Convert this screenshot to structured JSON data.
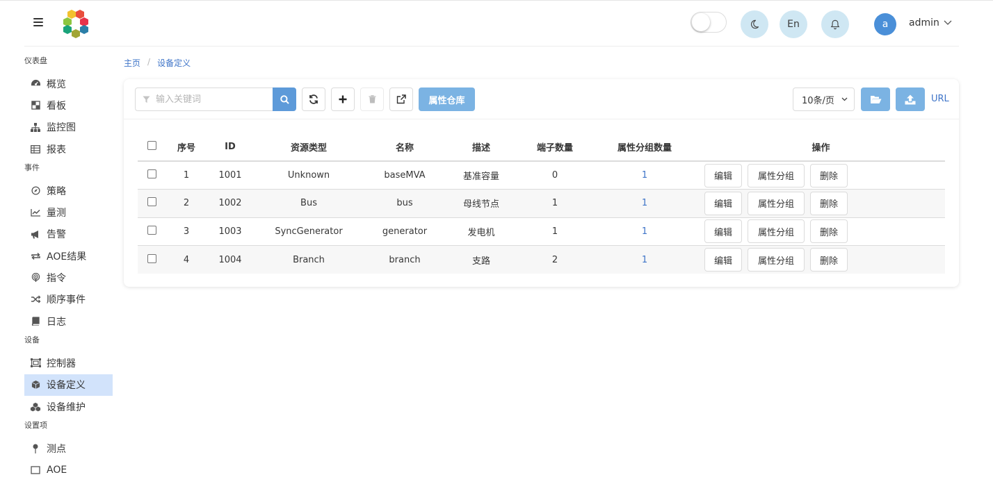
{
  "header": {
    "language_label": "En",
    "avatar_letter": "a",
    "username": "admin"
  },
  "sidebar": {
    "groups": [
      {
        "label": "仪表盘",
        "items": [
          {
            "label": "概览",
            "icon": "dashboard-icon"
          },
          {
            "label": "看板",
            "icon": "board-icon"
          },
          {
            "label": "监控图",
            "icon": "sitemap-icon"
          },
          {
            "label": "报表",
            "icon": "table-icon"
          }
        ]
      },
      {
        "label": "事件",
        "items": [
          {
            "label": "策略",
            "icon": "compass-icon"
          },
          {
            "label": "量测",
            "icon": "line-chart-icon"
          },
          {
            "label": "告警",
            "icon": "bullhorn-icon"
          },
          {
            "label": "AOE结果",
            "icon": "exchange-icon"
          },
          {
            "label": "指令",
            "icon": "podcast-icon"
          },
          {
            "label": "顺序事件",
            "icon": "random-icon"
          },
          {
            "label": "日志",
            "icon": "book-icon"
          }
        ]
      },
      {
        "label": "设备",
        "items": [
          {
            "label": "控制器",
            "icon": "object-group-icon"
          },
          {
            "label": "设备定义",
            "icon": "cube-icon",
            "active": true
          },
          {
            "label": "设备维护",
            "icon": "cubes-icon"
          }
        ]
      },
      {
        "label": "设置项",
        "items": [
          {
            "label": "测点",
            "icon": "map-pin-icon"
          },
          {
            "label": "AOE",
            "icon": "aoe-icon"
          }
        ]
      }
    ]
  },
  "breadcrumb": {
    "home": "主页",
    "current": "设备定义"
  },
  "toolbar": {
    "search_placeholder": "输入关键词",
    "property_repo_label": "属性仓库",
    "page_size_label": "10条/页",
    "url_label": "URL"
  },
  "table": {
    "headers": [
      "序号",
      "ID",
      "资源类型",
      "名称",
      "描述",
      "端子数量",
      "属性分组数量",
      "操作"
    ],
    "action_labels": {
      "edit": "编辑",
      "group": "属性分组",
      "delete": "删除"
    },
    "rows": [
      {
        "index": "1",
        "id": "1001",
        "type": "Unknown",
        "name": "baseMVA",
        "desc": "基准容量",
        "terminals": "0",
        "groups": "1"
      },
      {
        "index": "2",
        "id": "1002",
        "type": "Bus",
        "name": "bus",
        "desc": "母线节点",
        "terminals": "1",
        "groups": "1"
      },
      {
        "index": "3",
        "id": "1003",
        "type": "SyncGenerator",
        "name": "generator",
        "desc": "发电机",
        "terminals": "1",
        "groups": "1"
      },
      {
        "index": "4",
        "id": "1004",
        "type": "Branch",
        "name": "branch",
        "desc": "支路",
        "terminals": "2",
        "groups": "1"
      }
    ]
  },
  "colors": {
    "accent": "#5d9ad9",
    "light_accent": "#7bb3e3",
    "link": "#3e74c8",
    "active_nav": "#d2e3fb",
    "circle_button": "#cfe7f3"
  }
}
